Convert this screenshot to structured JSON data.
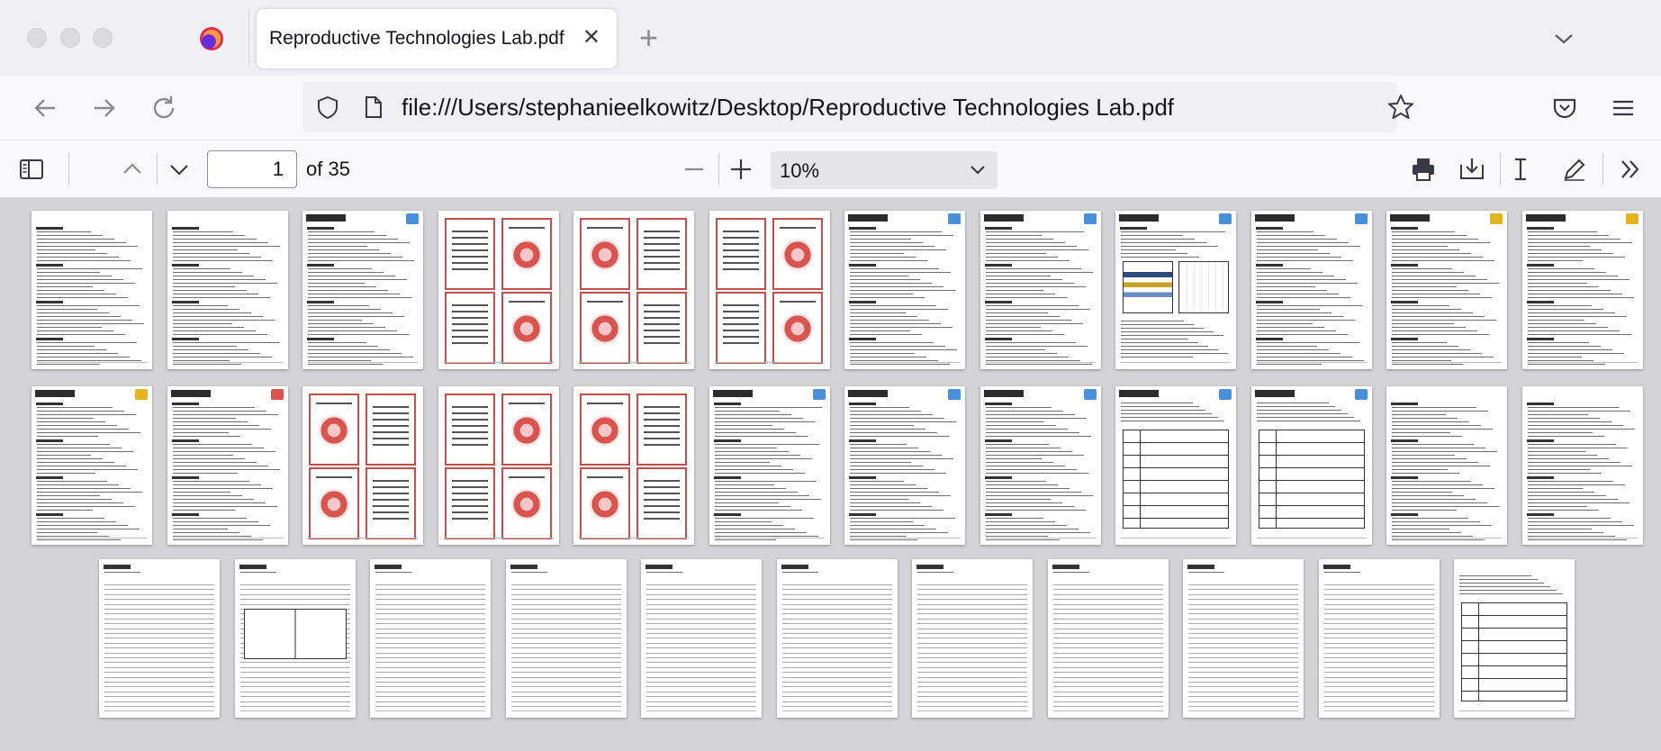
{
  "tab": {
    "title": "Reproductive Technologies Lab.pdf"
  },
  "url": {
    "text": "file:///Users/stephanieelkowitz/Desktop/Reproductive Technologies Lab.pdf"
  },
  "pdf_toolbar": {
    "page_number": "1",
    "page_count": "of 35",
    "zoom": "10%"
  },
  "icons": {
    "firefox": "firefox-logo-icon",
    "close_tab": "close-icon",
    "new_tab": "plus-icon",
    "tab_list": "chevron-down-icon",
    "back": "arrow-left-icon",
    "forward": "arrow-right-icon",
    "reload": "reload-icon",
    "shield": "shield-icon",
    "file": "file-icon",
    "bookmark": "star-icon",
    "pocket": "pocket-icon",
    "menu": "hamburger-menu-icon",
    "sidebar": "sidebar-toggle-icon",
    "prev": "chevron-up-icon",
    "next": "chevron-down-icon",
    "zoom_out": "minus-icon",
    "zoom_in": "plus-icon",
    "print": "printer-icon",
    "save": "download-icon",
    "text": "text-cursor-icon",
    "draw": "pen-icon",
    "more": "double-chevron-right-icon"
  },
  "colors": {
    "card_border": "#c0504d",
    "accent_badge_yellow": "#e6b422",
    "accent_badge_blue": "#4a90d9"
  },
  "thumbnails": {
    "count": 35
  }
}
